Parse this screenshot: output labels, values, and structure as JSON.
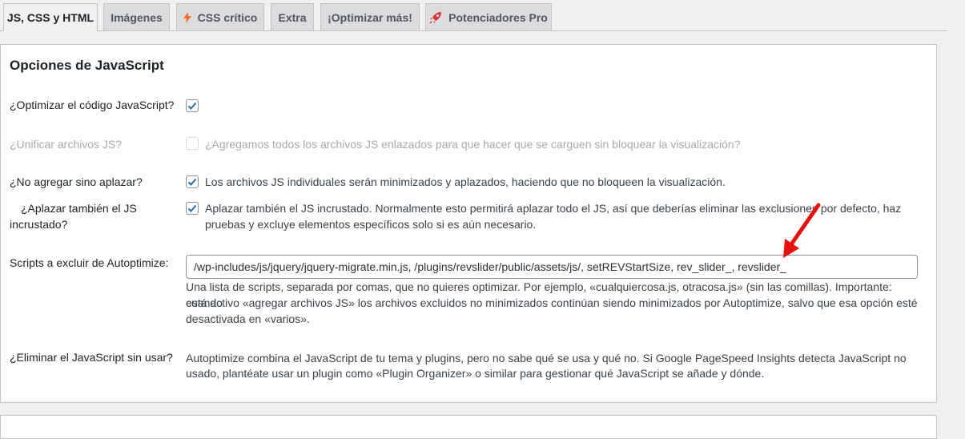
{
  "tabs": [
    {
      "label": "JS, CSS y HTML",
      "active": true
    },
    {
      "label": "Imágenes"
    },
    {
      "label": "CSS crítico",
      "icon": "lightning-icon"
    },
    {
      "label": "Extra"
    },
    {
      "label": "¡Optimizar más!"
    },
    {
      "label": "Potenciadores Pro",
      "icon": "rocket-icon"
    }
  ],
  "section": {
    "title": "Opciones de JavaScript"
  },
  "options": {
    "optimize": {
      "label": "¿Optimizar el código JavaScript?",
      "checked": true
    },
    "aggregate": {
      "label": "¿Unificar archivos JS?",
      "checked": false,
      "disabled": true,
      "text": "¿Agregamos todos los archivos JS enlazados para que hacer que se carguen sin bloquear la visualización?"
    },
    "defer": {
      "label": "¿No agregar sino aplazar?",
      "checked": true,
      "text": "Los archivos JS individuales serán minimizados y aplazados, haciendo que no bloqueen la visualización."
    },
    "defer_inline": {
      "label": "¿Aplazar también el JS incrustado?",
      "checked": true,
      "text_line1": "Aplazar también el JS incrustado. Normalmente esto permitirá aplazar todo el JS, así que deberías eliminar las exclusiones por defecto, haz",
      "text_line2": "pruebas y excluye elementos específicos solo si es aún necesario."
    }
  },
  "exclude": {
    "label": "Scripts a excluir de Autoptimize:",
    "value": "/wp-includes/js/jquery/jquery-migrate.min.js, /plugins/revslider/public/assets/js/, setREVStartSize, rev_slider_, revslider_",
    "desc_line1": "Una lista de scripts, separada por comas, que no quieres optimizar. Por ejemplo, «cualquiercosa.js, otracosa.js» (sin las comillas). Importante: cuando",
    "desc_line2": "está activo «agregar archivos JS» los archivos excluidos no minimizados continúan siendo minimizados por Autoptimize, salvo que esa opción esté",
    "desc_line3": "desactivada en «varios»."
  },
  "unused": {
    "label": "¿Eliminar el JavaScript sin usar?",
    "desc_line1": "Autoptimize combina el JavaScript de tu tema y plugins, pero no sabe qué se usa y qué no. Si Google PageSpeed Insights detecta JavaScript no",
    "desc_line2": "usado, plantéate usar un plugin como «Plugin Organizer» o similar para gestionar qué JavaScript se añade y dónde."
  },
  "colors": {
    "accent": "#2271b1",
    "annotation_arrow": "#e8110f",
    "bolt": "#f56e28",
    "rocket": "#d63638"
  }
}
